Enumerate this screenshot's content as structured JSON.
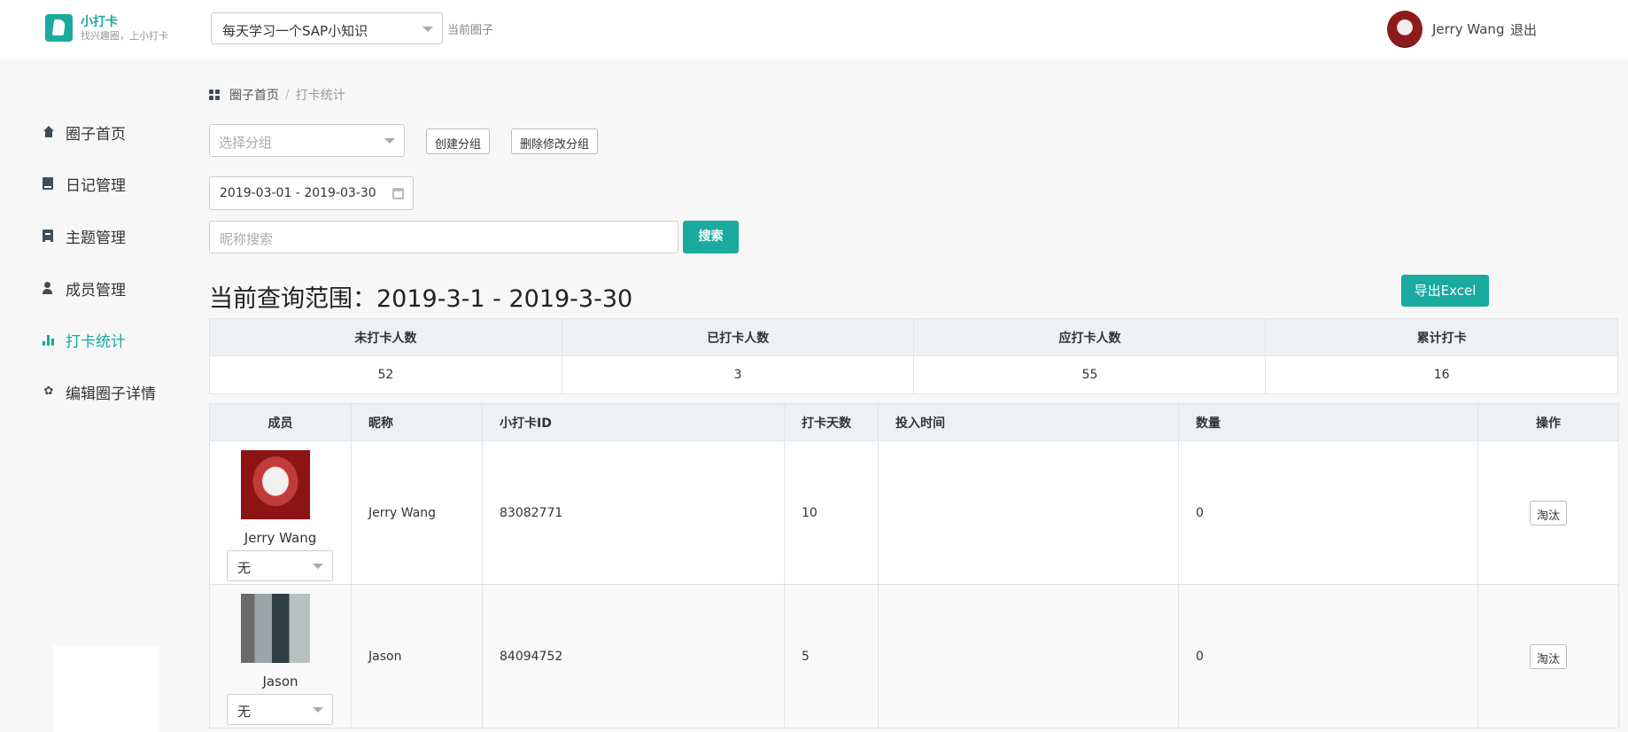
{
  "header": {
    "app_name": "小打卡",
    "slogan": "找兴趣圈，上小打卡",
    "circle_select_value": "每天学习一个SAP小知识",
    "current_circle_label": "当前圈子",
    "user_name": "Jerry Wang",
    "logout": "退出"
  },
  "sidebar": {
    "items": [
      {
        "label": "圈子首页",
        "icon": "home-icon"
      },
      {
        "label": "日记管理",
        "icon": "book-icon"
      },
      {
        "label": "主题管理",
        "icon": "document-icon"
      },
      {
        "label": "成员管理",
        "icon": "user-icon"
      },
      {
        "label": "打卡统计",
        "icon": "bar-chart-icon",
        "active": true
      },
      {
        "label": "编辑圈子详情",
        "icon": "gear-icon"
      }
    ],
    "active_color": "#1aaa9f"
  },
  "breadcrumb": {
    "home": "圈子首页",
    "separator": "/",
    "current": "打卡统计"
  },
  "filters": {
    "group_placeholder": "选择分组",
    "create_group": "创建分组",
    "delete_group": "删除修改分组",
    "date_range": "2019-03-01 - 2019-03-30",
    "nickname_placeholder": "昵称搜索",
    "search_button": "搜索"
  },
  "range_title": "当前查询范围：2019-3-1 - 2019-3-30",
  "export_button": "导出Excel",
  "summary": {
    "headers": [
      "未打卡人数",
      "已打卡人数",
      "应打卡人数",
      "累计打卡"
    ],
    "values": [
      "52",
      "3",
      "55",
      "16"
    ]
  },
  "members": {
    "headers": [
      "成员",
      "昵称",
      "小打卡ID",
      "打卡天数",
      "投入时间",
      "数量",
      "操作"
    ],
    "rows": [
      {
        "name": "Jerry Wang",
        "group": "无",
        "nickname": "Jerry Wang",
        "id": "83082771",
        "days": "10",
        "time": "",
        "count": "0",
        "action": "淘汰"
      },
      {
        "name": "Jason",
        "group": "无",
        "nickname": "Jason",
        "id": "84094752",
        "days": "5",
        "time": "",
        "count": "0",
        "action": "淘汰"
      }
    ]
  },
  "colors": {
    "accent": "#1aaa9f"
  }
}
